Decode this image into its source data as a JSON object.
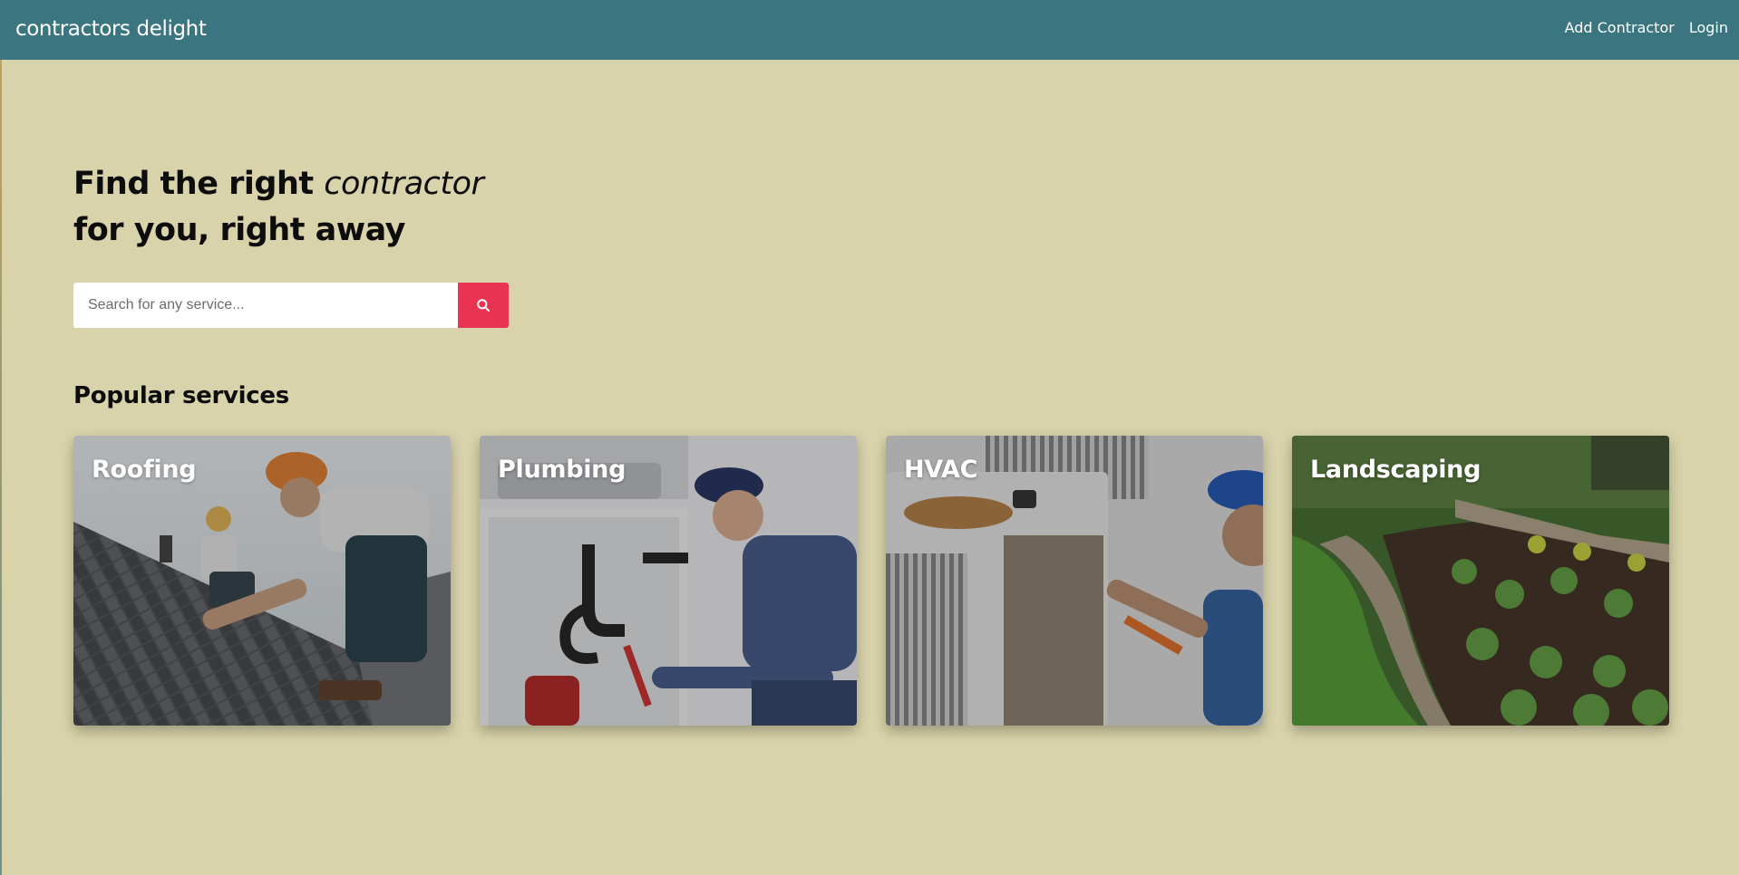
{
  "header": {
    "brand": "contractors delight",
    "links": [
      "Add Contractor",
      "Login"
    ]
  },
  "hero": {
    "title_part1": "Find the right ",
    "title_emphasis": "contractor",
    "title_line2": "for you, right away"
  },
  "search": {
    "placeholder": "Search for any service...",
    "button_icon": "search-icon"
  },
  "popular": {
    "title": "Popular services",
    "services": [
      {
        "label": "Roofing",
        "image": "roofer-workers-photo"
      },
      {
        "label": "Plumbing",
        "image": "plumber-photo"
      },
      {
        "label": "HVAC",
        "image": "hvac-technician-photo"
      },
      {
        "label": "Landscaping",
        "image": "garden-landscape-photo"
      }
    ]
  },
  "colors": {
    "navbar": "#3b7680",
    "background": "#d8d3aa",
    "search_button": "#e83452"
  }
}
